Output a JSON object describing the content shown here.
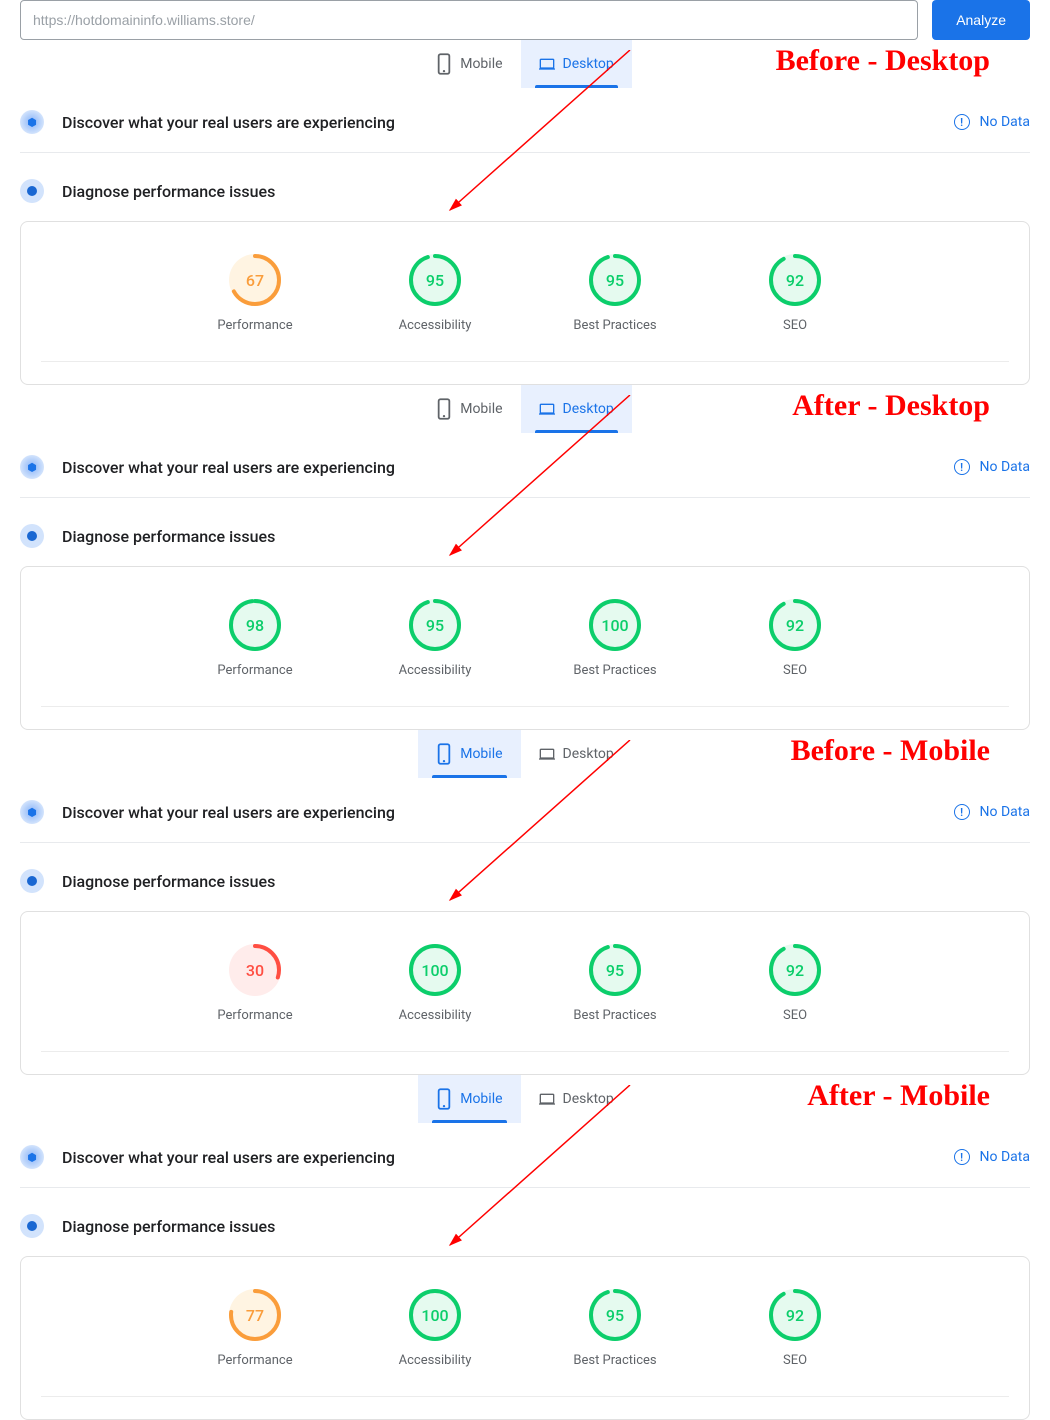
{
  "url_bar": {
    "value": "https://hotdomaininfo.williams.store/",
    "analyze_label": "Analyze"
  },
  "tabs": {
    "mobile": "Mobile",
    "desktop": "Desktop"
  },
  "discover": {
    "title": "Discover what your real users are experiencing",
    "no_data": "No Data"
  },
  "diagnose": {
    "title": "Diagnose performance issues"
  },
  "metrics": {
    "performance": "Performance",
    "accessibility": "Accessibility",
    "best_practices": "Best Practices",
    "seo": "SEO"
  },
  "annotations": {
    "before_desktop": "Before - Desktop",
    "after_desktop": "After - Desktop",
    "before_mobile": "Before - Mobile",
    "after_mobile": "After - Mobile"
  },
  "sections": {
    "before_desktop": {
      "active_tab": "desktop",
      "scores": {
        "performance": 67,
        "accessibility": 95,
        "best_practices": 95,
        "seo": 92
      }
    },
    "after_desktop": {
      "active_tab": "desktop",
      "scores": {
        "performance": 98,
        "accessibility": 95,
        "best_practices": 100,
        "seo": 92
      }
    },
    "before_mobile": {
      "active_tab": "mobile",
      "scores": {
        "performance": 30,
        "accessibility": 100,
        "best_practices": 95,
        "seo": 92
      }
    },
    "after_mobile": {
      "active_tab": "mobile",
      "scores": {
        "performance": 77,
        "accessibility": 100,
        "best_practices": 95,
        "seo": 92
      }
    }
  },
  "colors": {
    "green": "#0cce6b",
    "orange": "#fa9d3b",
    "red": "#ff4e42",
    "green_fill": "#e5faef",
    "orange_fill": "#fff4e2",
    "red_fill": "#ffeceb"
  },
  "chart_data": [
    {
      "type": "bar",
      "title": "Before - Desktop",
      "categories": [
        "Performance",
        "Accessibility",
        "Best Practices",
        "SEO"
      ],
      "values": [
        67,
        95,
        95,
        92
      ],
      "ylim": [
        0,
        100
      ]
    },
    {
      "type": "bar",
      "title": "After - Desktop",
      "categories": [
        "Performance",
        "Accessibility",
        "Best Practices",
        "SEO"
      ],
      "values": [
        98,
        95,
        100,
        92
      ],
      "ylim": [
        0,
        100
      ]
    },
    {
      "type": "bar",
      "title": "Before - Mobile",
      "categories": [
        "Performance",
        "Accessibility",
        "Best Practices",
        "SEO"
      ],
      "values": [
        30,
        100,
        95,
        92
      ],
      "ylim": [
        0,
        100
      ]
    },
    {
      "type": "bar",
      "title": "After - Mobile",
      "categories": [
        "Performance",
        "Accessibility",
        "Best Practices",
        "SEO"
      ],
      "values": [
        77,
        100,
        95,
        92
      ],
      "ylim": [
        0,
        100
      ]
    }
  ]
}
